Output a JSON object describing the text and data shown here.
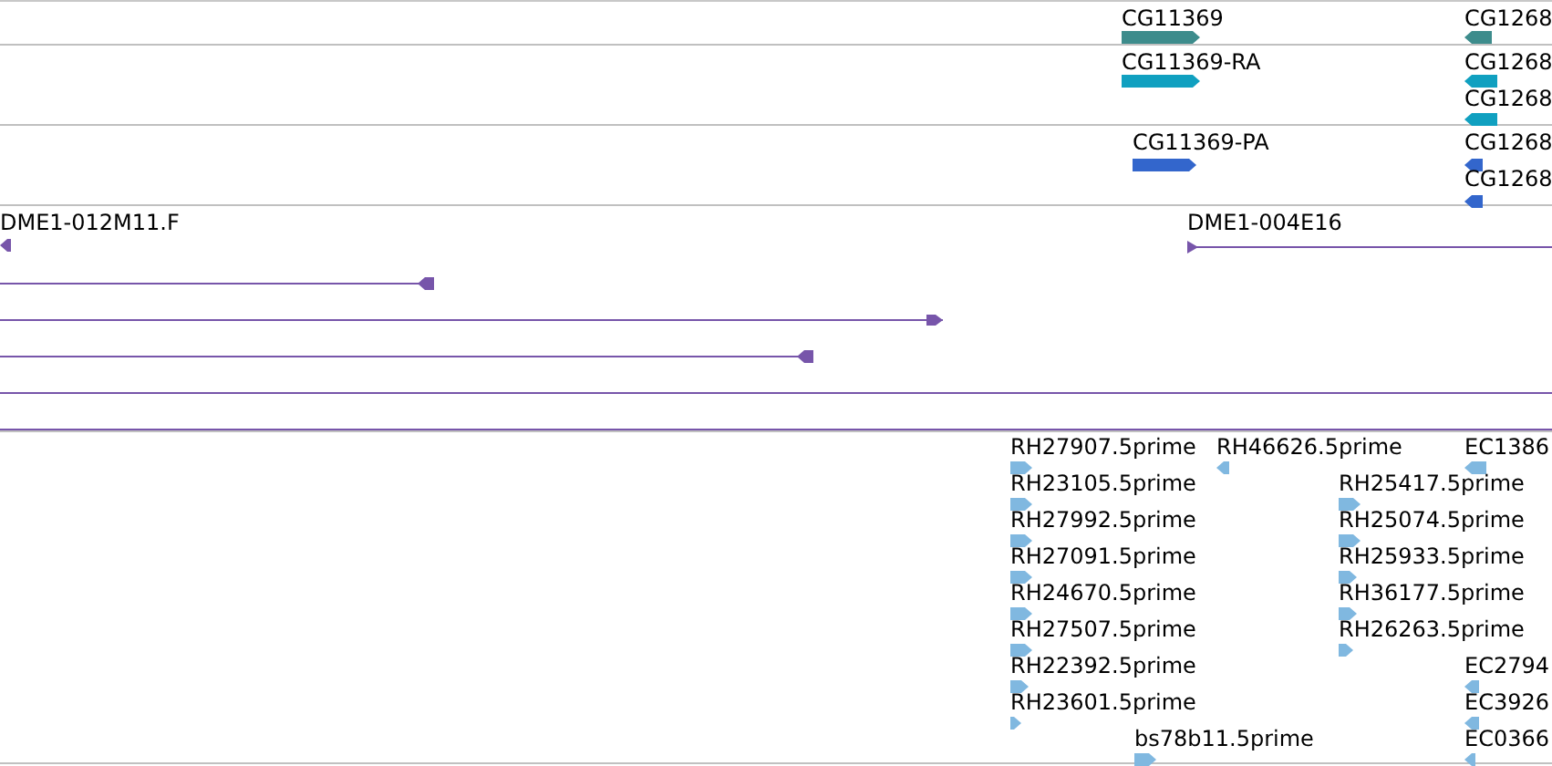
{
  "tracks": [
    {
      "color": "#3d8c8c",
      "features": [
        {
          "kind": "bar",
          "label": "CG11369",
          "reverse": false
        },
        {
          "kind": "bar",
          "label": "CG1268",
          "reverse": true
        }
      ]
    },
    {
      "color": "#10a0c0",
      "features": [
        {
          "kind": "bar",
          "label": "CG11369-RA",
          "reverse": false
        },
        {
          "kind": "bar",
          "label": "CG1268",
          "reverse": true
        },
        {
          "kind": "bar",
          "label": "CG1268",
          "reverse": true
        }
      ]
    },
    {
      "color": "#3366cc",
      "features": [
        {
          "kind": "bar",
          "label": "CG11369-PA",
          "reverse": false
        },
        {
          "kind": "bar",
          "label": "CG1268",
          "reverse": true
        },
        {
          "kind": "bar",
          "label": "CG1268",
          "reverse": true
        }
      ]
    },
    {
      "color": "#7755aa",
      "features": [
        {
          "kind": "bar",
          "label": "DME1-012M11.F",
          "reverse": true
        },
        {
          "kind": "line",
          "label": "DME1-004E16",
          "reverse": false,
          "head": true
        },
        {
          "kind": "line",
          "reverse": true,
          "head": true
        },
        {
          "kind": "line",
          "reverse": false,
          "head": true
        },
        {
          "kind": "line",
          "reverse": true,
          "head": true
        },
        {
          "kind": "line",
          "head": false
        },
        {
          "kind": "line",
          "head": false
        }
      ]
    },
    {
      "color": "#80b8e0",
      "features": [
        {
          "kind": "bar",
          "label": "RH27907.5prime",
          "reverse": false
        },
        {
          "kind": "bar",
          "label": "RH46626.5prime",
          "reverse": true
        },
        {
          "kind": "bar",
          "label": "EC1386",
          "reverse": true
        },
        {
          "kind": "bar",
          "label": "RH23105.5prime",
          "reverse": false
        },
        {
          "kind": "bar",
          "label": "RH25417.5prime",
          "reverse": false
        },
        {
          "kind": "bar",
          "label": "RH27992.5prime",
          "reverse": false
        },
        {
          "kind": "bar",
          "label": "RH25074.5prime",
          "reverse": false
        },
        {
          "kind": "bar",
          "label": "RH27091.5prime",
          "reverse": false
        },
        {
          "kind": "bar",
          "label": "RH25933.5prime",
          "reverse": false
        },
        {
          "kind": "bar",
          "label": "RH24670.5prime",
          "reverse": false
        },
        {
          "kind": "bar",
          "label": "RH36177.5prime",
          "reverse": false
        },
        {
          "kind": "bar",
          "label": "RH27507.5prime",
          "reverse": false
        },
        {
          "kind": "bar",
          "label": "RH26263.5prime",
          "reverse": false
        },
        {
          "kind": "bar",
          "label": "RH22392.5prime",
          "reverse": false
        },
        {
          "kind": "bar",
          "label": "EC2794",
          "reverse": true
        },
        {
          "kind": "bar",
          "label": "RH23601.5prime",
          "reverse": false
        },
        {
          "kind": "bar",
          "label": "EC3926",
          "reverse": true
        },
        {
          "kind": "bar",
          "label": "bs78b11.5prime",
          "reverse": false
        },
        {
          "kind": "bar",
          "label": "EC0366",
          "reverse": true
        }
      ]
    }
  ]
}
